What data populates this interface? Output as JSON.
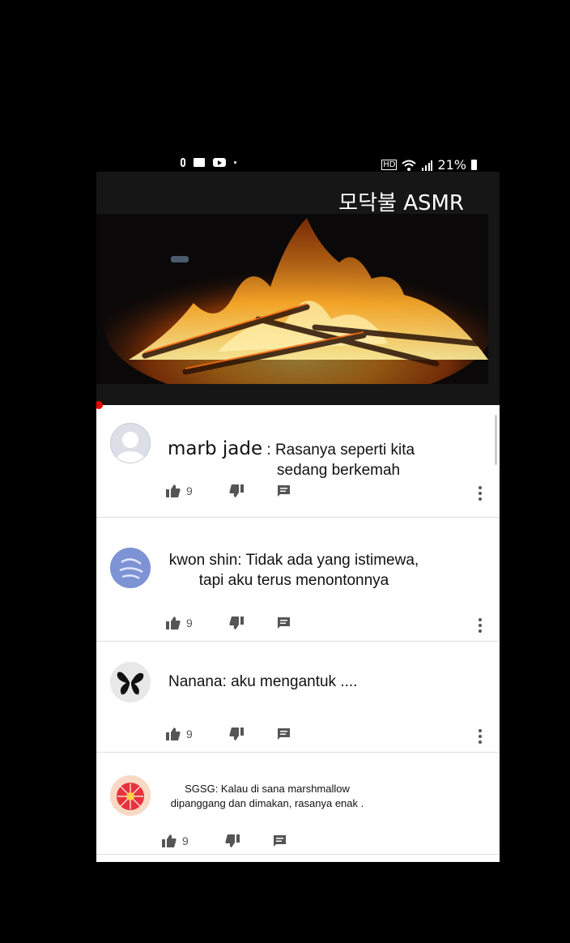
{
  "status_bar": {
    "signal_text": "21%"
  },
  "video": {
    "title": "모닥불 ASMR"
  },
  "comments": [
    {
      "author": "marb jade",
      "separator": " : ",
      "line1": "Rasanya seperti kita",
      "line2": "sedang berkemah",
      "likes": "9"
    },
    {
      "author": "kwon shin",
      "separator": ": ",
      "line1": "Tidak ada yang istimewa,",
      "line2": "tapi aku  terus menontonnya",
      "likes": "9"
    },
    {
      "author": "Nanana",
      "separator": ": ",
      "line1": "aku mengantuk ....",
      "likes": "9"
    },
    {
      "author": "SGSG",
      "separator": ": ",
      "line1": "Kalau di sana marshmallow",
      "line2": "dipanggang dan dimakan, rasanya enak .",
      "likes": "9"
    }
  ],
  "colors": {
    "accent": "#e00000",
    "background": "#000000",
    "card": "#ffffff"
  }
}
